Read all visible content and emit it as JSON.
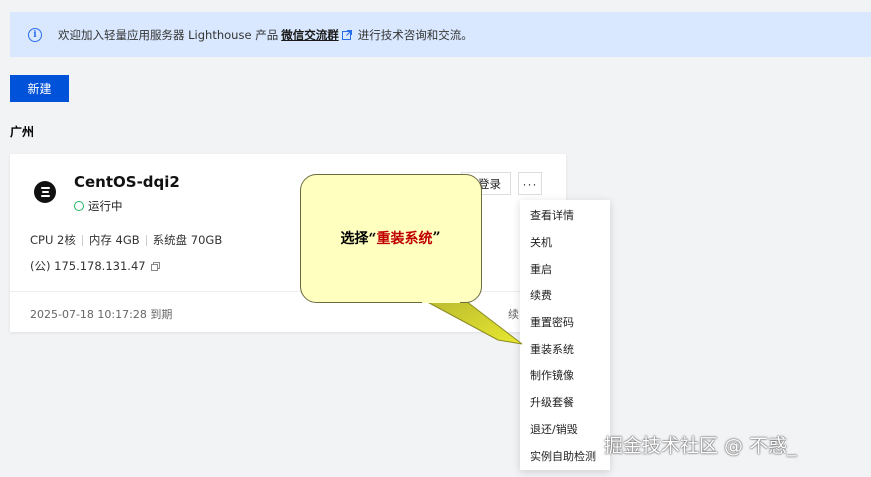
{
  "banner": {
    "text_before": "欢迎加入轻量应用服务器 Lighthouse 产品",
    "link_text": "微信交流群",
    "text_after": "进行技术咨询和交流。",
    "icon": "info-icon"
  },
  "toolbar": {
    "new_label": "新建"
  },
  "region": "广州",
  "instance": {
    "name": "CentOS-dqi2",
    "status": "运行中",
    "cpu": "CPU 2核",
    "memory": "内存 4GB",
    "disk": "系统盘 70GB",
    "ip": "(公) 175.178.131.47",
    "expire": "2025-07-18 10:17:28 到期",
    "renew": "续",
    "login_label": "登录",
    "more_label": "···"
  },
  "menu": {
    "items": [
      "查看详情",
      "关机",
      "重启",
      "续费",
      "重置密码",
      "重装系统",
      "制作镜像",
      "升级套餐",
      "退还/销毁",
      "实例自助检测"
    ]
  },
  "callout": {
    "prefix": "选择“",
    "highlight": "重装系统",
    "suffix": "”"
  },
  "watermark": "掘金技术社区 @ 不惑_",
  "colors": {
    "primary": "#0052d9",
    "banner_bg": "#d9e8ff",
    "callout_fill": "#ffffc0",
    "status_green": "#1fb560"
  }
}
